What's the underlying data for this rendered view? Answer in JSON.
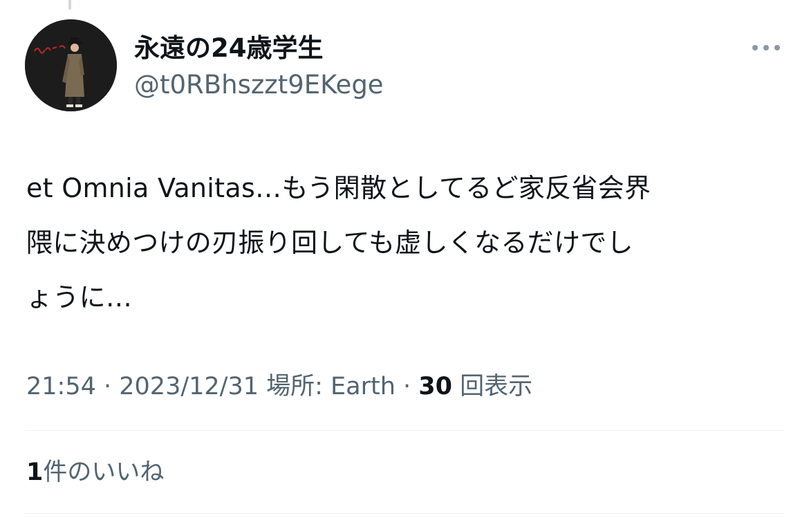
{
  "author": {
    "display_name": "永遠の24歳学生",
    "handle": "@t0RBhszzt9EKege",
    "avatar_icon": "avatar-image"
  },
  "more_icon": "more-horizontal-icon",
  "tweet": {
    "lines": [
      "et Omnia Vanitas…もう閑散としてるど家反省会界",
      "隈に決めつけの刃振り回しても虚しくなるだけでし",
      "ょうに…"
    ]
  },
  "meta": {
    "time": "21:54",
    "separator1": " · ",
    "date": "2023/12/31",
    "location_label": " 場所: Earth",
    "separator2": " · ",
    "views_count": "30",
    "views_label": " 回表示"
  },
  "likes": {
    "count": "1",
    "label": "件のいいね"
  },
  "colors": {
    "text_primary": "#0f1419",
    "text_secondary": "#536471",
    "divider": "#eff3f4"
  }
}
